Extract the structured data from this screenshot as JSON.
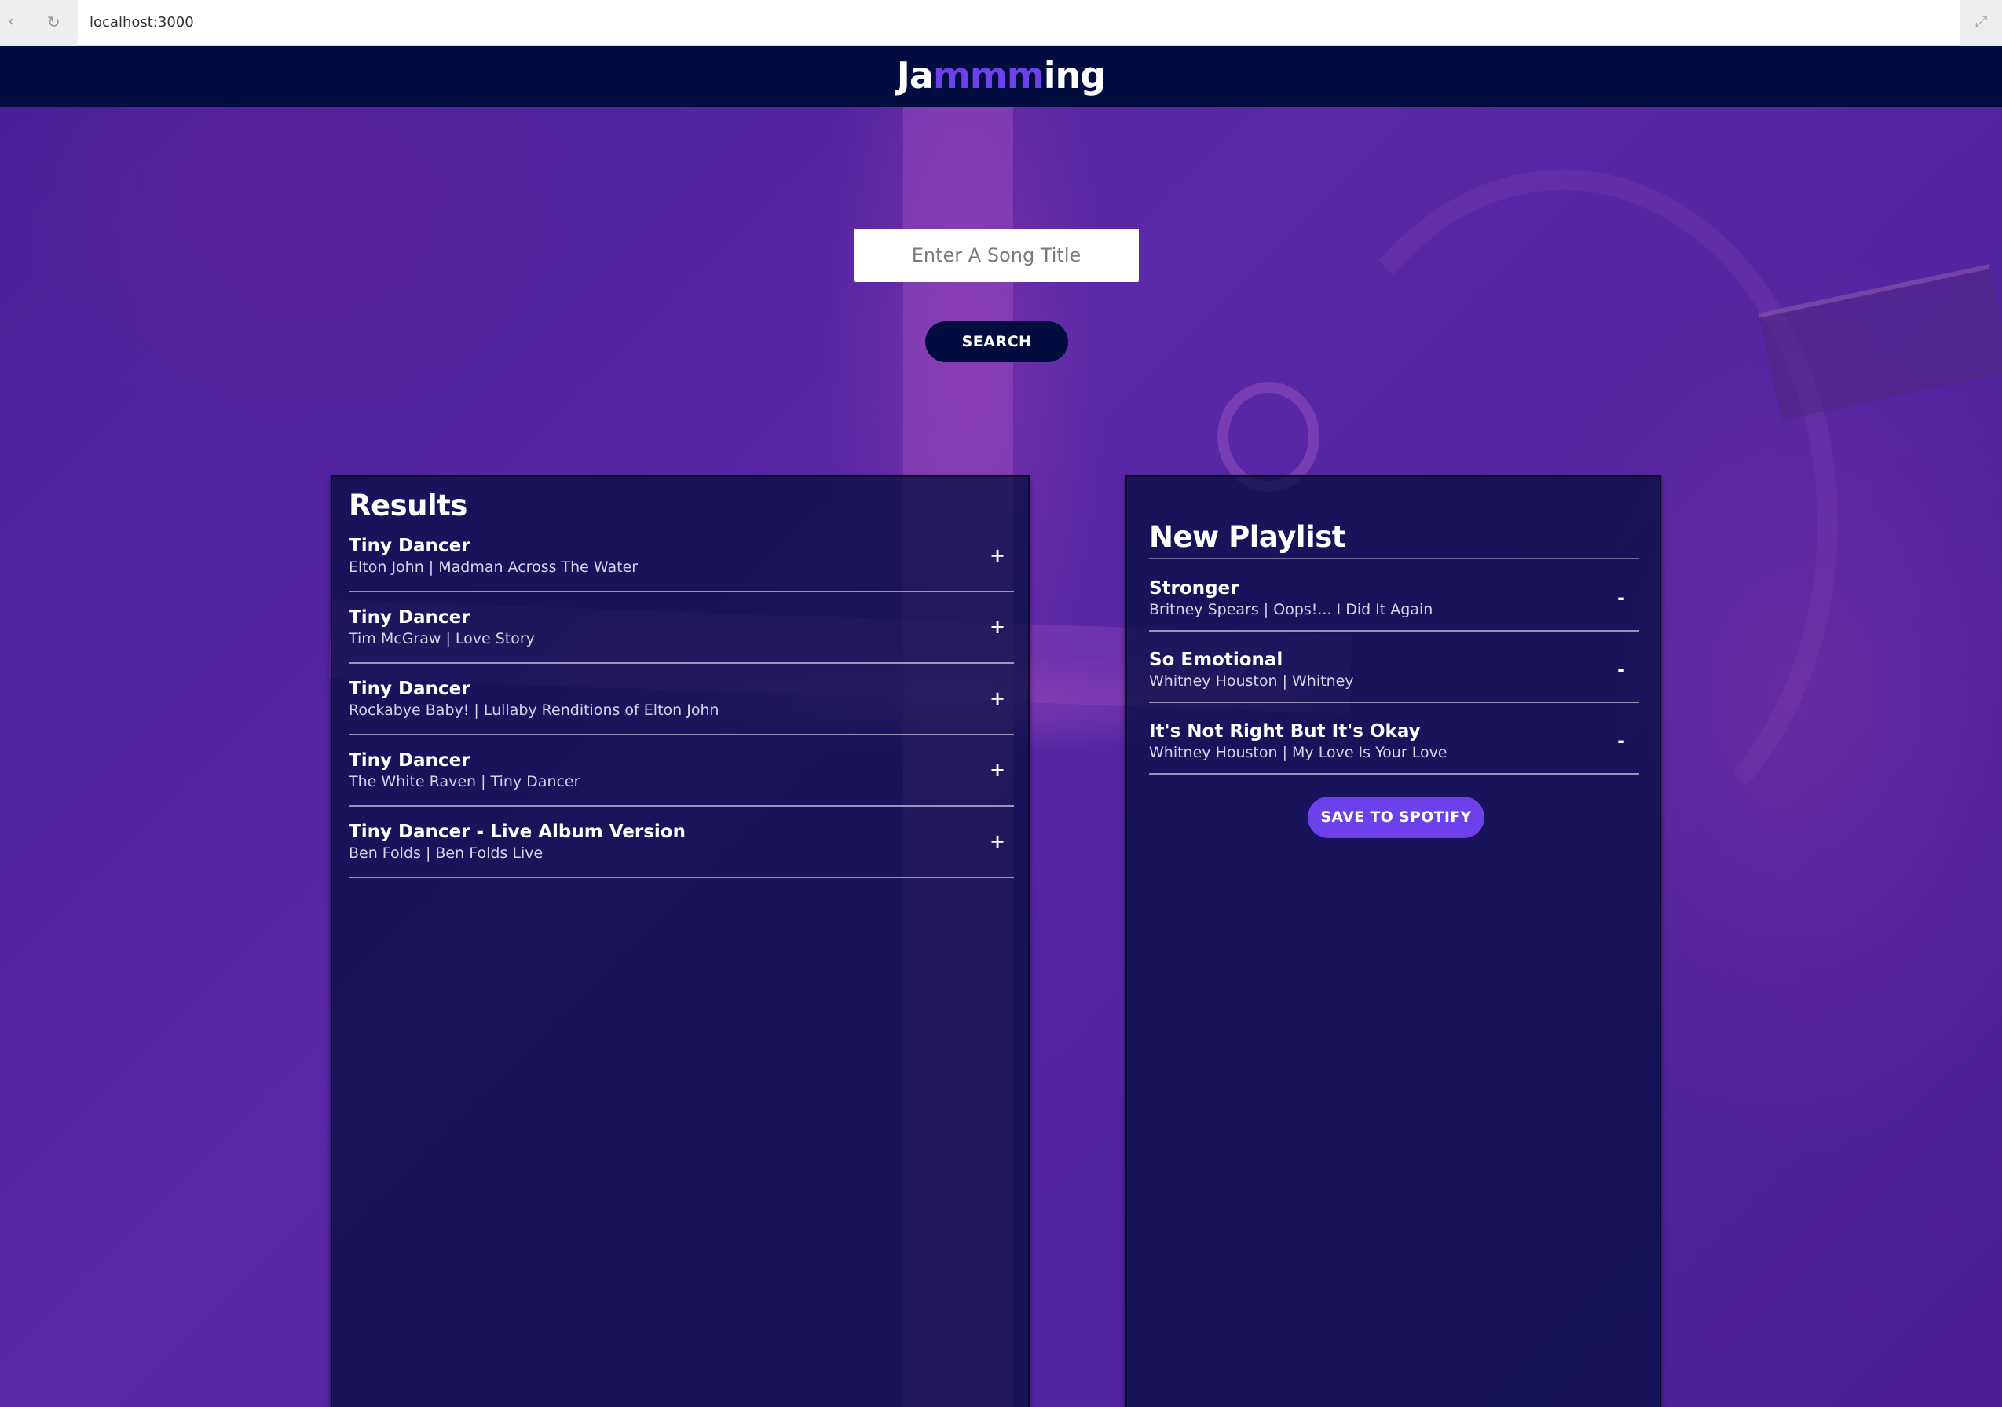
{
  "browser": {
    "url": "localhost:3000",
    "back_icon": "back-icon",
    "reload_icon": "reload-icon",
    "fullscreen_icon": "fullscreen-icon"
  },
  "header": {
    "logo_prefix": "Ja",
    "logo_highlight": "mmm",
    "logo_suffix": "ing",
    "highlight_color": "#6c41ec",
    "background_color": "#010c3f"
  },
  "search": {
    "placeholder": "Enter A Song Title",
    "value": "",
    "button_label": "SEARCH"
  },
  "results": {
    "title": "Results",
    "action_symbol": "+",
    "tracks": [
      {
        "name": "Tiny Dancer",
        "info": "Elton John | Madman Across The Water"
      },
      {
        "name": "Tiny Dancer",
        "info": "Tim McGraw | Love Story"
      },
      {
        "name": "Tiny Dancer",
        "info": "Rockabye Baby! | Lullaby Renditions of Elton John"
      },
      {
        "name": "Tiny Dancer",
        "info": "The White Raven | Tiny Dancer"
      },
      {
        "name": "Tiny Dancer - Live Album Version",
        "info": "Ben Folds | Ben Folds Live"
      }
    ]
  },
  "playlist": {
    "name": "New Playlist",
    "action_symbol": "-",
    "tracks": [
      {
        "name": "Stronger",
        "info": "Britney Spears | Oops!... I Did It Again"
      },
      {
        "name": "So Emotional",
        "info": "Whitney Houston | Whitney"
      },
      {
        "name": "It's Not Right But It's Okay",
        "info": "Whitney Houston | My Love Is Your Love"
      }
    ],
    "save_label": "SAVE TO SPOTIFY",
    "save_color": "#6c41ec"
  }
}
